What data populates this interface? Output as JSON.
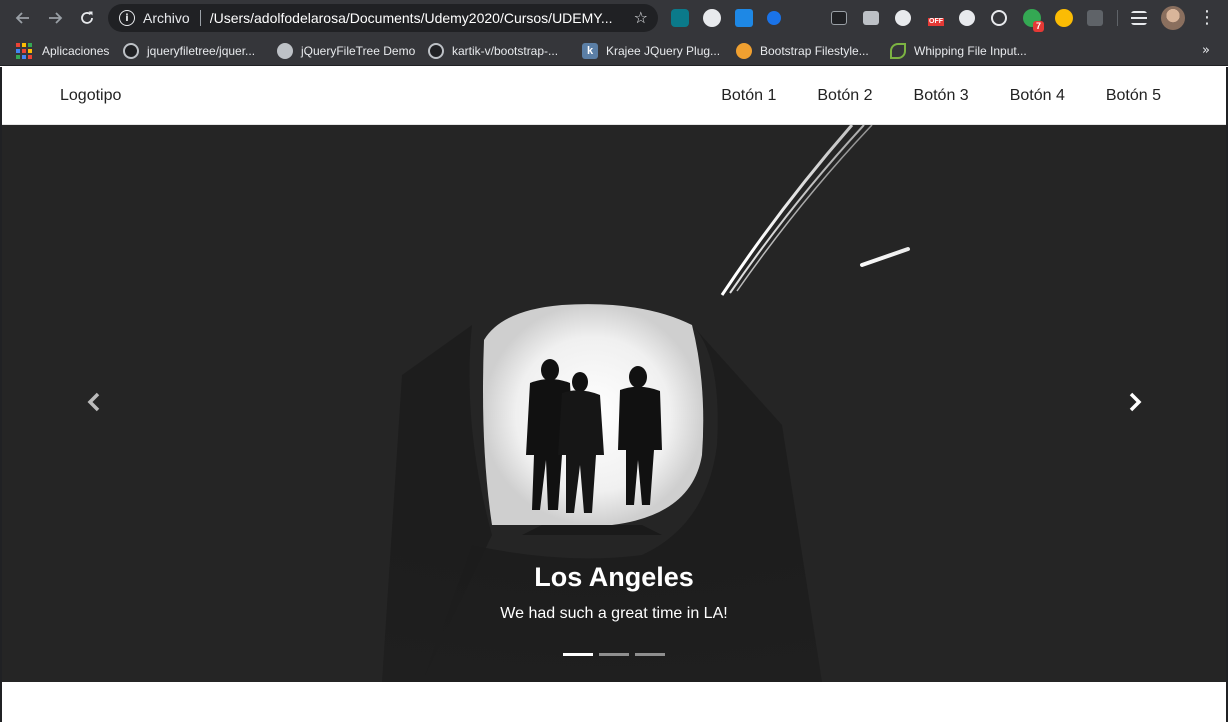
{
  "browser": {
    "scheme_label": "Archivo",
    "url": "/Users/adolfodelarosa/Documents/Udemy2020/Cursos/UDEMY...",
    "back_icon": "arrow-left-icon",
    "forward_icon": "arrow-right-icon",
    "reload_icon": "reload-icon",
    "star_icon": "star-icon",
    "extension_badge": "7",
    "extension_off_label": "OFF"
  },
  "bookmarks": [
    {
      "label": "Aplicaciones",
      "icon": "apps-grid-icon"
    },
    {
      "label": "jqueryfiletree/jquer...",
      "icon": "github-icon"
    },
    {
      "label": "jQueryFileTree Demo",
      "icon": "globe-icon"
    },
    {
      "label": "kartik-v/bootstrap-...",
      "icon": "github-icon"
    },
    {
      "label": "Krajee JQuery Plug...",
      "icon": "krajee-icon"
    },
    {
      "label": "Bootstrap Filestyle...",
      "icon": "filestyle-icon"
    },
    {
      "label": "Whipping File Input...",
      "icon": "leaf-icon"
    }
  ],
  "site": {
    "logo": "Logotipo",
    "nav": [
      "Botón 1",
      "Botón 2",
      "Botón 3",
      "Botón 4",
      "Botón 5"
    ]
  },
  "carousel": {
    "title": "Los Angeles",
    "text": "We had such a great time in LA!",
    "slides_count": 3,
    "active_index": 0,
    "prev_icon": "chevron-left-icon",
    "next_icon": "chevron-right-icon"
  },
  "colors": {
    "chrome_bg": "#35363a",
    "omnibox_bg": "#202124",
    "carousel_bg": "#252525"
  }
}
